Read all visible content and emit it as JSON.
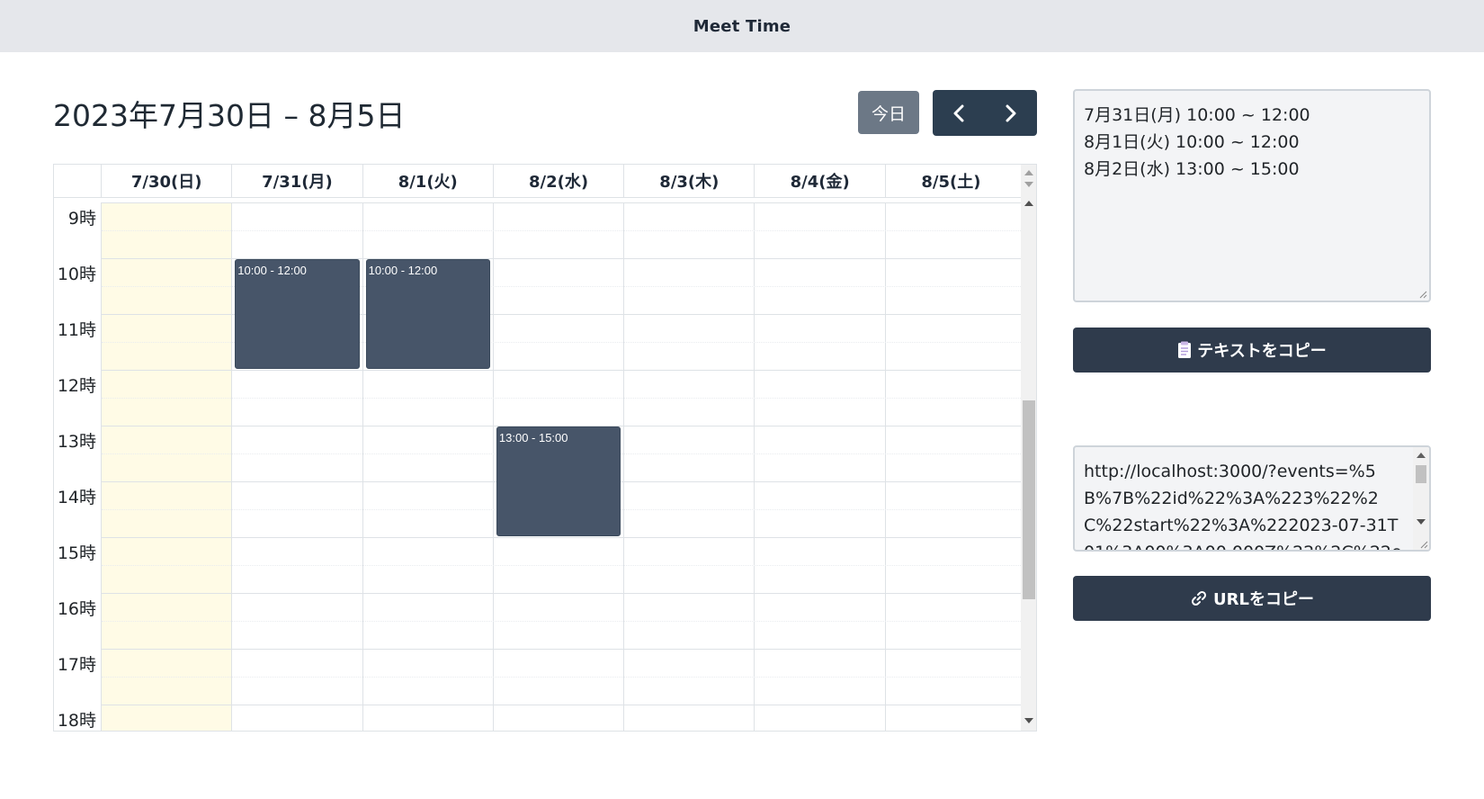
{
  "app": {
    "title": "Meet Time"
  },
  "toolbar": {
    "range_title": "2023年7月30日 – 8月5日",
    "today_label": "今日",
    "prev_icon": "chevron-left-icon",
    "next_icon": "chevron-right-icon"
  },
  "calendar": {
    "days": [
      {
        "label": "7/30(日)",
        "today": true
      },
      {
        "label": "7/31(月)",
        "today": false
      },
      {
        "label": "8/1(火)",
        "today": false
      },
      {
        "label": "8/2(水)",
        "today": false
      },
      {
        "label": "8/3(木)",
        "today": false
      },
      {
        "label": "8/4(金)",
        "today": false
      },
      {
        "label": "8/5(土)",
        "today": false
      }
    ],
    "hours": [
      "9時",
      "10時",
      "11時",
      "12時",
      "13時",
      "14時",
      "15時",
      "16時",
      "17時",
      "18時"
    ],
    "first_hour": 9,
    "events": [
      {
        "day": 1,
        "start": 10,
        "end": 12,
        "label": "10:00 - 12:00"
      },
      {
        "day": 2,
        "start": 10,
        "end": 12,
        "label": "10:00 - 12:00"
      },
      {
        "day": 3,
        "start": 13,
        "end": 15,
        "label": "13:00 - 15:00"
      }
    ],
    "colors": {
      "event": "#475569",
      "today_bg": "#fffbe6"
    }
  },
  "summary": {
    "lines": [
      "7月31日(月) 10:00 ~ 12:00",
      "8月1日(火) 10:00 ~ 12:00",
      "8月2日(水) 13:00 ~ 15:00"
    ],
    "copy_text_label": "テキストをコピー",
    "copy_text_icon": "clipboard-icon"
  },
  "share": {
    "url": "http://localhost:3000/?events=%5B%7B%22id%22%3A%223%22%2C%22start%22%3A%222023-07-31T01%3A00%3A00.000Z%22%2C%22e",
    "copy_url_label": "URLをコピー",
    "copy_url_icon": "link-icon"
  }
}
